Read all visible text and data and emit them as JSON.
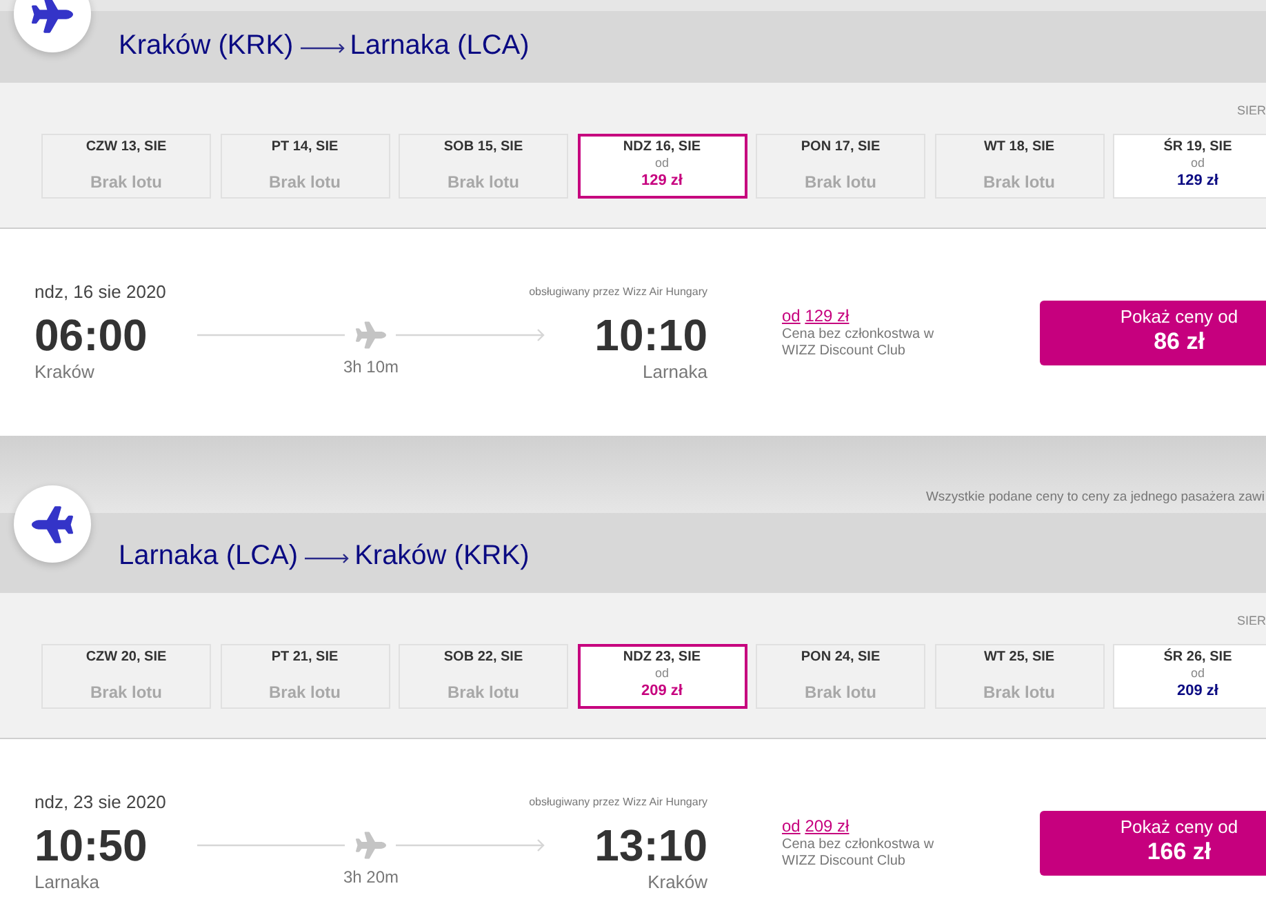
{
  "sections": [
    {
      "kind": "trip",
      "plane_reversed": false,
      "origin": "Kraków (KRK)",
      "destination": "Larnaka (LCA)",
      "month_label": "SIER",
      "dates": [
        {
          "kind": "none",
          "label": "CZW 13, SIE",
          "status": "Brak lotu",
          "selected": false
        },
        {
          "kind": "none",
          "label": "PT 14, SIE",
          "status": "Brak lotu",
          "selected": false
        },
        {
          "kind": "none",
          "label": "SOB 15, SIE",
          "status": "Brak lotu",
          "selected": false
        },
        {
          "kind": "price",
          "label": "NDZ 16, SIE",
          "from": "od",
          "price": "129 zł",
          "selected": true
        },
        {
          "kind": "none",
          "label": "PON 17, SIE",
          "status": "Brak lotu",
          "selected": false
        },
        {
          "kind": "none",
          "label": "WT 18, SIE",
          "status": "Brak lotu",
          "selected": false
        },
        {
          "kind": "price",
          "label": "ŚR 19, SIE",
          "from": "od",
          "price": "129 zł",
          "selected": false
        }
      ],
      "flight": {
        "date": "ndz, 16 sie 2020",
        "operator": "obsługiwany przez Wizz Air Hungary",
        "departure_time": "06:00",
        "departure_city": "Kraków",
        "duration": "3h 10m",
        "arrival_time": "10:10",
        "arrival_city": "Larnaka",
        "fare_from": "od",
        "fare_price": "129 zł",
        "fare_note": "Cena bez członkostwa w WIZZ Discount Club",
        "button_label": "Pokaż ceny od",
        "button_price": "86 zł"
      }
    },
    {
      "kind": "notice",
      "text": "Wszystkie podane ceny to ceny za jednego pasażera zawi"
    },
    {
      "kind": "trip",
      "plane_reversed": true,
      "origin": "Larnaka (LCA)",
      "destination": "Kraków (KRK)",
      "month_label": "SIER",
      "dates": [
        {
          "kind": "none",
          "label": "CZW 20, SIE",
          "status": "Brak lotu",
          "selected": false
        },
        {
          "kind": "none",
          "label": "PT 21, SIE",
          "status": "Brak lotu",
          "selected": false
        },
        {
          "kind": "none",
          "label": "SOB 22, SIE",
          "status": "Brak lotu",
          "selected": false
        },
        {
          "kind": "price",
          "label": "NDZ 23, SIE",
          "from": "od",
          "price": "209 zł",
          "selected": true
        },
        {
          "kind": "none",
          "label": "PON 24, SIE",
          "status": "Brak lotu",
          "selected": false
        },
        {
          "kind": "none",
          "label": "WT 25, SIE",
          "status": "Brak lotu",
          "selected": false
        },
        {
          "kind": "price",
          "label": "ŚR 26, SIE",
          "from": "od",
          "price": "209 zł",
          "selected": false
        }
      ],
      "flight": {
        "date": "ndz, 23 sie 2020",
        "operator": "obsługiwany przez Wizz Air Hungary",
        "departure_time": "10:50",
        "departure_city": "Larnaka",
        "duration": "3h 20m",
        "arrival_time": "13:10",
        "arrival_city": "Kraków",
        "fare_from": "od",
        "fare_price": "209 zł",
        "fare_note": "Cena bez członkostwa w WIZZ Discount Club",
        "button_label": "Pokaż ceny od",
        "button_price": "166 zł"
      }
    }
  ]
}
